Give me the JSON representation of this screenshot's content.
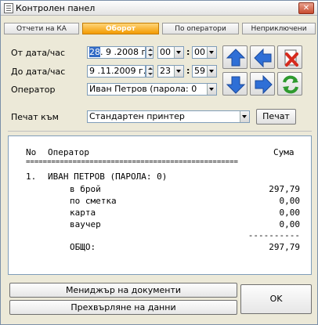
{
  "window": {
    "title": "Контролен панел",
    "close_glyph": "✕"
  },
  "tabs": [
    {
      "label": "Отчети на КА",
      "active": false
    },
    {
      "label": "Оборот",
      "active": true
    },
    {
      "label": "По оператори",
      "active": false
    },
    {
      "label": "Неприключени",
      "active": false
    }
  ],
  "filter": {
    "from_label": "От дата/час",
    "from_date_day": "28",
    "from_date_rest": ". 9 .2008 г.",
    "from_hour": "00",
    "from_minute": "00",
    "to_label": "До дата/час",
    "to_date": "9 .11.2009 г.",
    "to_hour": "23",
    "to_minute": "59",
    "operator_label": "Оператор",
    "operator_value": "Иван Петров (парола: 0",
    "colon": ":"
  },
  "print": {
    "label": "Печат към",
    "printer": "Стандартен принтер",
    "button": "Печат"
  },
  "report": {
    "col_no": "No",
    "col_operator": "Оператор",
    "col_sum": "Сума",
    "rule": "==================================================",
    "row_no": "1.",
    "row_operator": "ИВАН ПЕТРОВ (ПАРОЛА: 0)",
    "lines": [
      {
        "label": "в брой",
        "value": "297,79"
      },
      {
        "label": "по сметка",
        "value": "0,00"
      },
      {
        "label": "карта",
        "value": "0,00"
      },
      {
        "label": "ваучер",
        "value": "0,00"
      }
    ],
    "dash_rule": "----------",
    "total_label": "ОБЩО:",
    "total_value": "297,79"
  },
  "buttons": {
    "doc_manager": "Мениджър на документи",
    "convert_data": "Прехвърляне на данни",
    "ok": "OK"
  },
  "icons": {
    "up": "arrow-up-icon",
    "left": "arrow-left-icon",
    "clear": "clear-icon",
    "down": "arrow-down-icon",
    "right": "arrow-right-icon",
    "refresh": "refresh-icon"
  },
  "colors": {
    "accent": "#f39b00",
    "nav_blue": "#2f6fd6",
    "refresh_green": "#2e9a2e"
  }
}
